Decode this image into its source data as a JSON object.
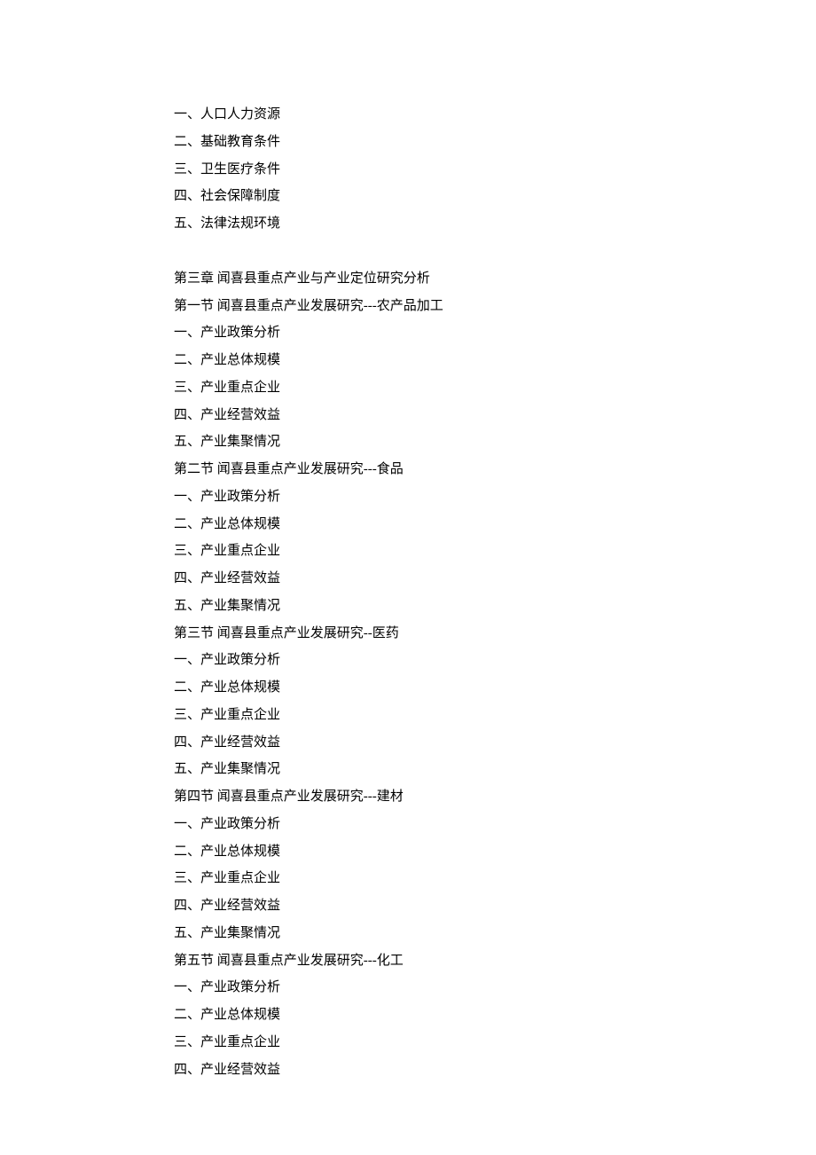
{
  "lines": [
    "一、人口人力资源",
    "二、基础教育条件",
    "三、卫生医疗条件",
    "四、社会保障制度",
    "五、法律法规环境",
    "",
    "第三章  闻喜县重点产业与产业定位研究分析",
    "第一节  闻喜县重点产业发展研究---农产品加工",
    "一、产业政策分析",
    "二、产业总体规模",
    "三、产业重点企业",
    "四、产业经营效益",
    "五、产业集聚情况",
    "第二节  闻喜县重点产业发展研究---食品",
    "一、产业政策分析",
    "二、产业总体规模",
    "三、产业重点企业",
    "四、产业经营效益",
    "五、产业集聚情况",
    "第三节  闻喜县重点产业发展研究--医药",
    "一、产业政策分析",
    "二、产业总体规模",
    "三、产业重点企业",
    "四、产业经营效益",
    "五、产业集聚情况",
    "第四节  闻喜县重点产业发展研究---建材",
    "一、产业政策分析",
    "二、产业总体规模",
    "三、产业重点企业",
    "四、产业经营效益",
    "五、产业集聚情况",
    "第五节  闻喜县重点产业发展研究---化工",
    "一、产业政策分析",
    "二、产业总体规模",
    "三、产业重点企业",
    "四、产业经营效益"
  ]
}
